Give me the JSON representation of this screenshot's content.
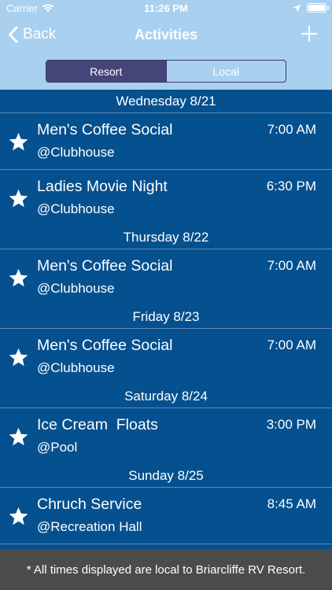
{
  "status_bar": {
    "carrier": "Carrier",
    "time": "11:26 PM"
  },
  "nav": {
    "back_label": "Back",
    "title": "Activities"
  },
  "segments": [
    {
      "label": "Resort",
      "selected": true
    },
    {
      "label": "Local",
      "selected": false
    }
  ],
  "days": [
    {
      "date": "Wednesday 8/21",
      "events": [
        {
          "name": "Men's Coffee Social",
          "location": "@Clubhouse",
          "time": "7:00 AM"
        },
        {
          "name": "Ladies Movie Night",
          "location": "@Clubhouse",
          "time": "6:30 PM"
        }
      ]
    },
    {
      "date": "Thursday 8/22",
      "events": [
        {
          "name": "Men's Coffee Social",
          "location": "@Clubhouse",
          "time": "7:00 AM"
        }
      ]
    },
    {
      "date": "Friday 8/23",
      "events": [
        {
          "name": "Men's Coffee Social",
          "location": "@Clubhouse",
          "time": "7:00 AM"
        }
      ]
    },
    {
      "date": "Saturday 8/24",
      "events": [
        {
          "name": "Ice Cream  Floats",
          "location": "@Pool",
          "time": "3:00 PM"
        }
      ]
    },
    {
      "date": "Sunday 8/25",
      "events": [
        {
          "name": "Chruch Service",
          "location": "@Recreation Hall",
          "time": "8:45 AM"
        }
      ]
    }
  ],
  "footer": {
    "note": "* All times displayed are local to Briarcliffe RV Resort."
  },
  "colors": {
    "header_bg": "#a9d0ef",
    "list_bg": "#05508f",
    "segment_active": "#46457a",
    "footer_bg": "#4b4b4b"
  },
  "icons": {
    "back": "chevron-left-icon",
    "add": "plus-icon",
    "event": "star-icon",
    "wifi": "wifi-icon",
    "location": "location-arrow-icon",
    "battery": "battery-icon"
  }
}
